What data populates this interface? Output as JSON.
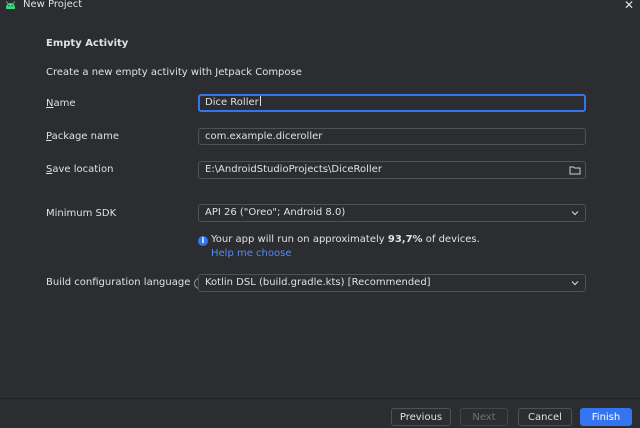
{
  "window": {
    "title": "New Project",
    "close_glyph": "✕"
  },
  "section": {
    "heading": "Empty Activity",
    "description": "Create a new empty activity with Jetpack Compose"
  },
  "form": {
    "name": {
      "label_first": "N",
      "label_rest": "ame",
      "value": "Dice Roller"
    },
    "package": {
      "label_first": "P",
      "label_rest": "ackage name",
      "value": "com.example.diceroller"
    },
    "save_location": {
      "label_first": "S",
      "label_rest": "ave location",
      "value": "E:\\AndroidStudioProjects\\DiceRoller"
    },
    "min_sdk": {
      "label": "Minimum SDK",
      "value": "API 26 (\"Oreo\"; Android 8.0)"
    },
    "info": {
      "prefix": "Your app will run on approximately ",
      "percent": "93,7%",
      "suffix": " of devices."
    },
    "help_link": "Help me choose",
    "build_lang": {
      "label": "Build configuration language",
      "value": "Kotlin DSL (build.gradle.kts) [Recommended]"
    }
  },
  "buttons": {
    "previous": "Previous",
    "next": "Next",
    "cancel": "Cancel",
    "finish": "Finish"
  },
  "colors": {
    "accent": "#3574f0",
    "background": "#2b2d30",
    "link": "#548af7"
  }
}
